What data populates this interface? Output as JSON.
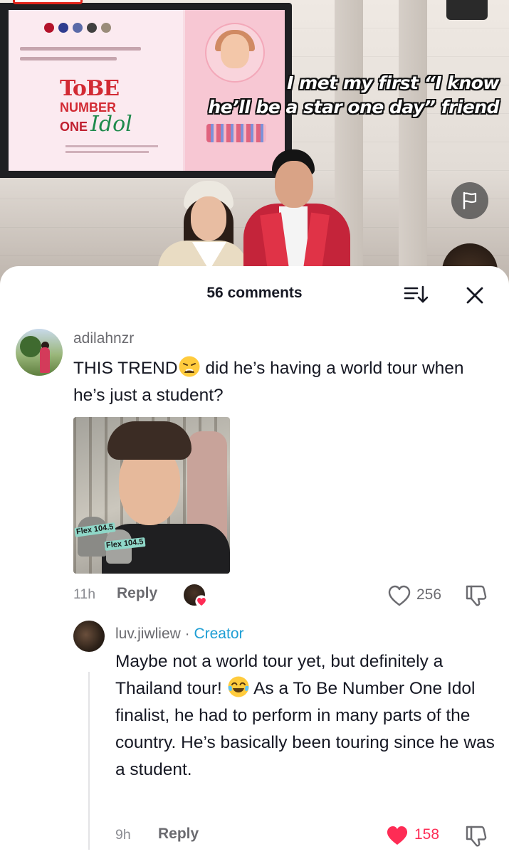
{
  "video": {
    "caption_line1": "I met my first “I know",
    "caption_line2": "he’ll be a star one day” friend",
    "poster_logo": {
      "to_be": "ToBE",
      "number": "NUMBER",
      "one": "ONE",
      "idol": "Idol"
    },
    "flag_icon": "flag-icon"
  },
  "header": {
    "comment_count_label": "56 comments",
    "sort_icon": "sort-icon",
    "close_icon": "close-icon"
  },
  "comments": [
    {
      "username": "adilahnzr",
      "text_part1": "THIS TREND",
      "emoji1": "weary-face",
      "text_part2": " did he’s having a world tour when he’s just a student?",
      "image_text": [
        "Flex 104.5",
        "Flex 104.5"
      ],
      "time": "11h",
      "reply_label": "Reply",
      "like_count": "256",
      "creator_liked": true
    },
    {
      "username": "luv.jiwliew",
      "separator": " · ",
      "creator_label": "Creator",
      "text_part1": "Maybe not a world tour yet, but definitely a Thailand tour! ",
      "emoji1": "tears-of-joy",
      "text_part2": " As a To Be Number One Idol finalist, he had to perform in many parts of the country. He’s basically been touring since he was a student.",
      "time": "9h",
      "reply_label": "Reply",
      "like_count": "158",
      "liked": true
    }
  ],
  "colors": {
    "accent_like": "#fe2c55",
    "creator": "#1e9ed4",
    "text_primary": "#161823",
    "text_secondary": "#6b6b70"
  }
}
